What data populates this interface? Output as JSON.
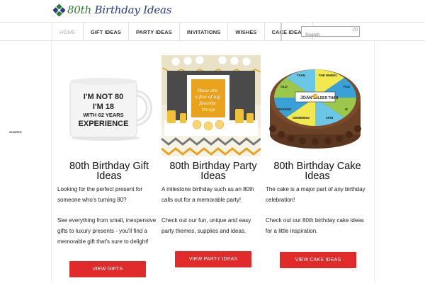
{
  "site": {
    "logo_number": "80th",
    "logo_rest": " Birthday Ideas"
  },
  "nav": {
    "items": [
      {
        "label": "HOME"
      },
      {
        "label": "GIFT IDEAS"
      },
      {
        "label": "PARTY IDEAS"
      },
      {
        "label": "INVITATIONS"
      },
      {
        "label": "WISHES"
      },
      {
        "label": "CAKE IDEAS"
      }
    ]
  },
  "search": {
    "placeholder": "Search",
    "button_label": "20"
  },
  "sidebar": {
    "shares_label": "SHARES"
  },
  "cards": [
    {
      "title": "80th Birthday Gift Ideas",
      "text_1": "Looking for the perfect present for someone who's turning 80?",
      "text_2": "See everything from small, inexpensive gifts to luxury presents - you'll find a memorable gift that's sure to delight!",
      "button": "VIEW GIFTS",
      "image": {
        "line_1": "I'M NOT 80",
        "line_2": "I'M 18",
        "line_3": "WITH 62 YEARS",
        "line_4": "EXPERIENCE"
      }
    },
    {
      "title": "80th Birthday Party Ideas",
      "text_1": "A milestone birthday such as an 80th calls out for a memorable party!",
      "text_2": "Check out our fun, unique and easy party themes, supplies and ideas.",
      "button": "VIEW PARTY IDEAS",
      "image": {
        "sign": "these are a few of my favorite things"
      }
    },
    {
      "title": "80th Birthday Cake Ideas",
      "text_1": "The cake is a major part of any birthday celebration!",
      "text_2": "Check out our 80th birthday cake ideas for a little inspiration.",
      "button": "VIEW CAKE IDEAS",
      "image": {
        "labels": [
          "THE WHEEL",
          "YOU",
          "OLDER THAN",
          "JOAN'S",
          "TAKE",
          "SWIMMING",
          "IS",
          "SPIN",
          "TRADING",
          "OLD"
        ]
      }
    }
  ],
  "colors": {
    "accent": "#e12a2a",
    "logo_blue": "#2b3a8c",
    "logo_green": "#2e7d32"
  }
}
